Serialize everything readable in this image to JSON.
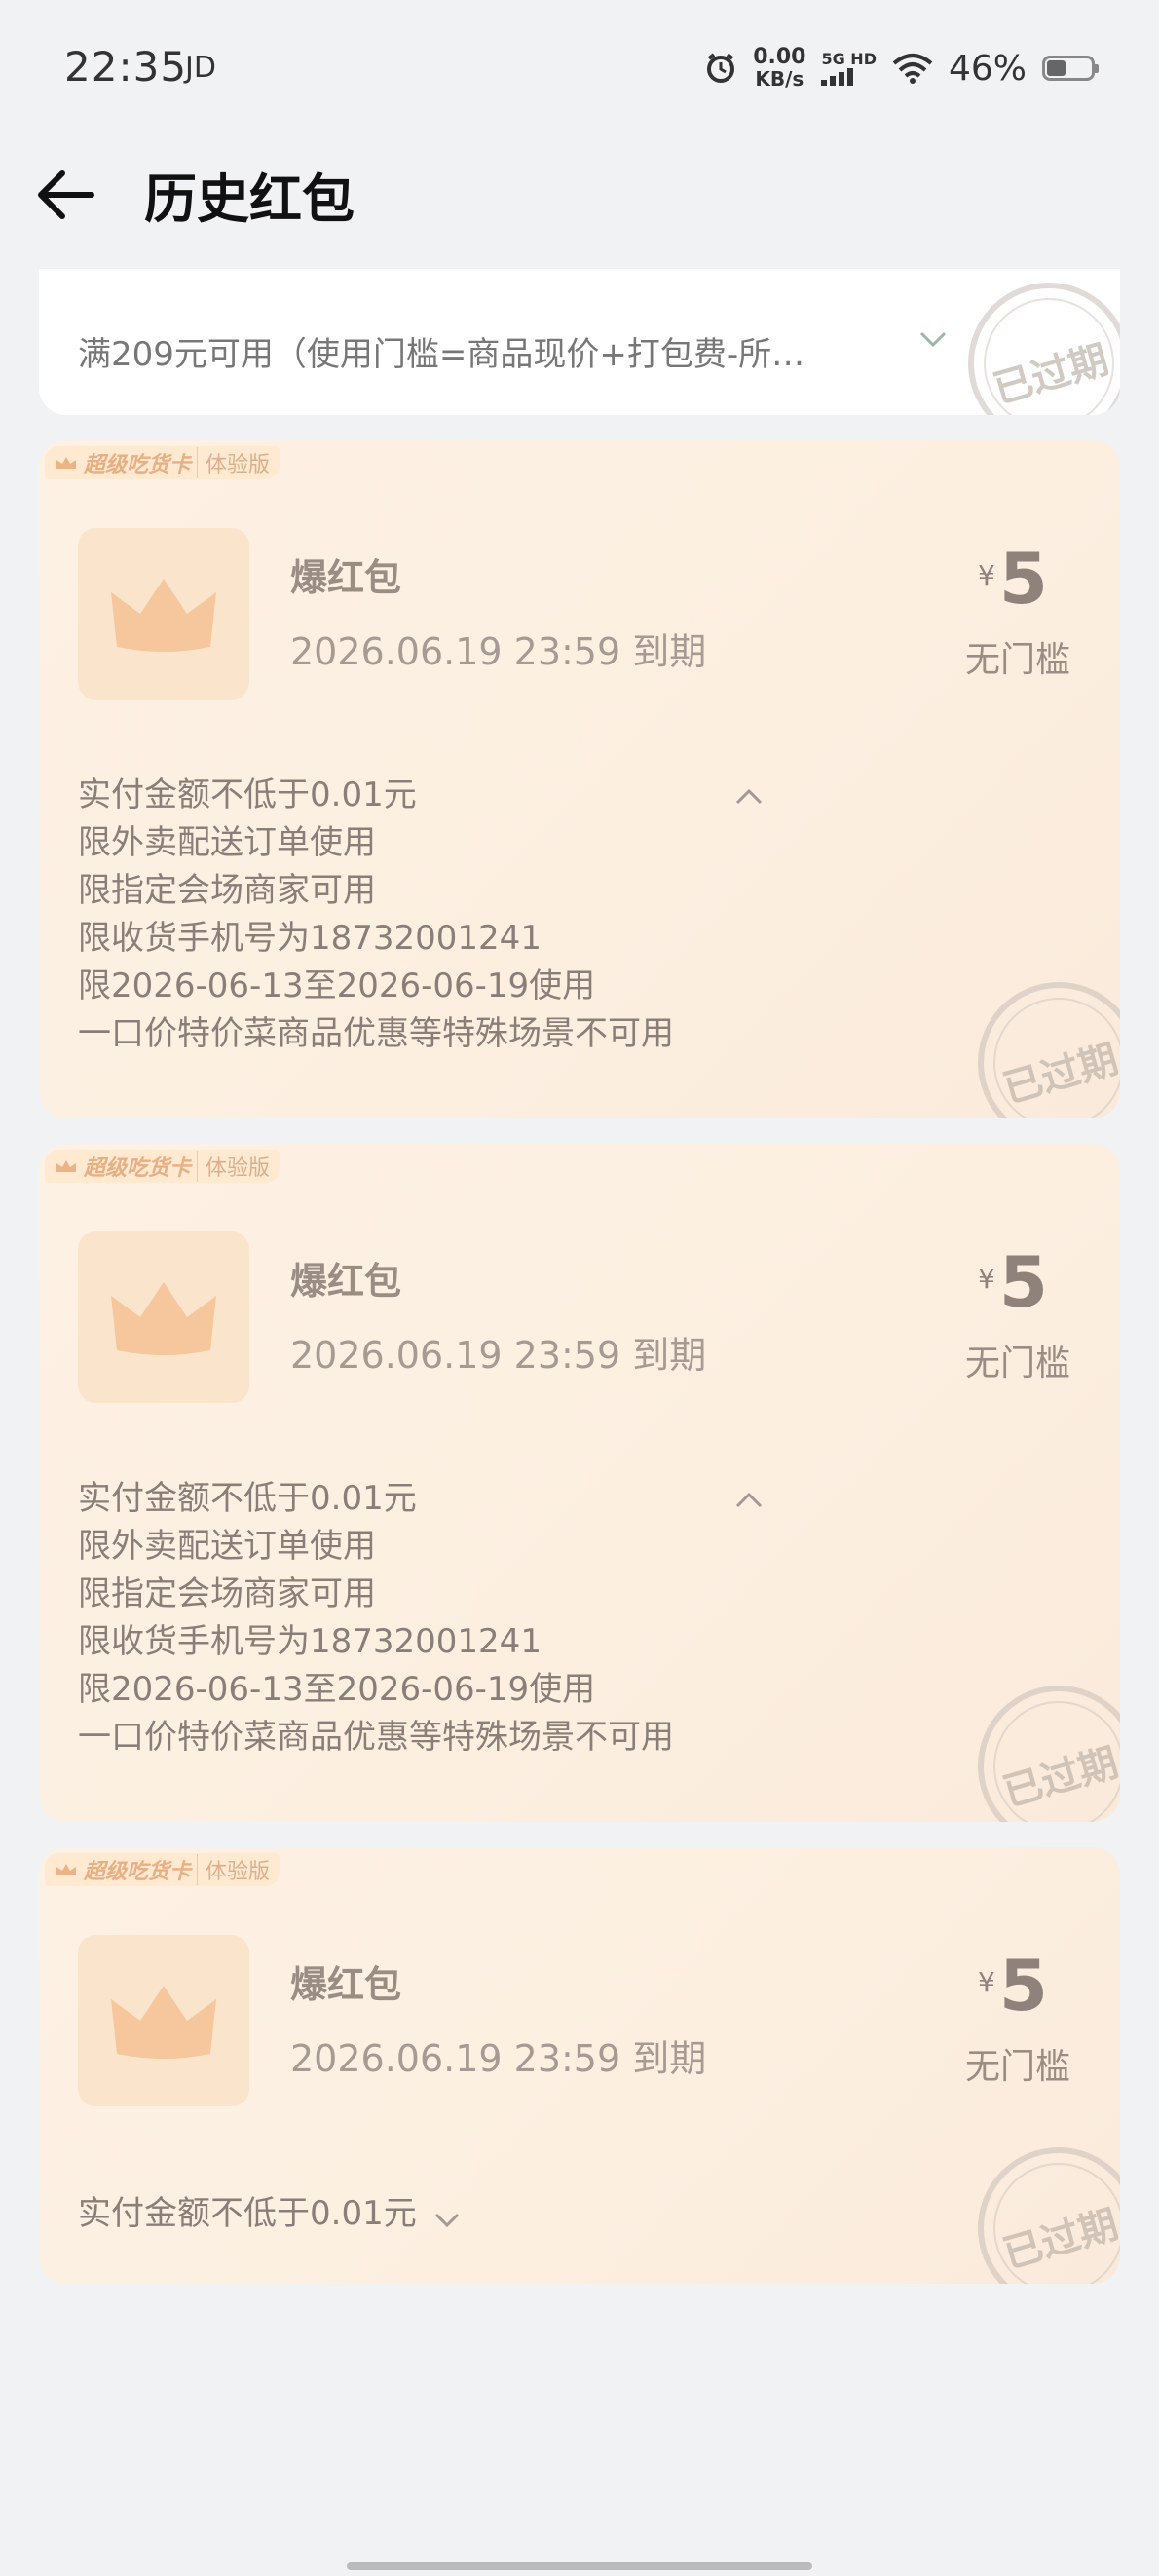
{
  "status_bar": {
    "time": "22:35",
    "carrier": "JD",
    "net_speed": "0.00",
    "net_unit": "KB/s",
    "signal_label": "5G HD",
    "battery": "46%"
  },
  "header": {
    "title": "历史红包"
  },
  "partial_card": {
    "condition": "满209元可用（使用门槛=商品现价+打包费-所…",
    "stamp": "已过期"
  },
  "cards": [
    {
      "tag_brand": "超级吃货卡",
      "tag_version": "体验版",
      "name": "爆红包",
      "expiry": "2026.06.19 23:59 到期",
      "currency": "¥",
      "amount": "5",
      "threshold": "无门槛",
      "rules": [
        "实付金额不低于0.01元",
        "限外卖配送订单使用",
        "限指定会场商家可用",
        "限收货手机号为18732001241",
        "限2026-06-13至2026-06-19使用",
        "一口价特价菜商品优惠等特殊场景不可用"
      ],
      "stamp": "已过期"
    },
    {
      "tag_brand": "超级吃货卡",
      "tag_version": "体验版",
      "name": "爆红包",
      "expiry": "2026.06.19 23:59 到期",
      "currency": "¥",
      "amount": "5",
      "threshold": "无门槛",
      "rules": [
        "实付金额不低于0.01元",
        "限外卖配送订单使用",
        "限指定会场商家可用",
        "限收货手机号为18732001241",
        "限2026-06-13至2026-06-19使用",
        "一口价特价菜商品优惠等特殊场景不可用"
      ],
      "stamp": "已过期"
    },
    {
      "tag_brand": "超级吃货卡",
      "tag_version": "体验版",
      "name": "爆红包",
      "expiry": "2026.06.19 23:59 到期",
      "currency": "¥",
      "amount": "5",
      "threshold": "无门槛",
      "rules": [
        "实付金额不低于0.01元"
      ],
      "stamp": "已过期"
    }
  ]
}
